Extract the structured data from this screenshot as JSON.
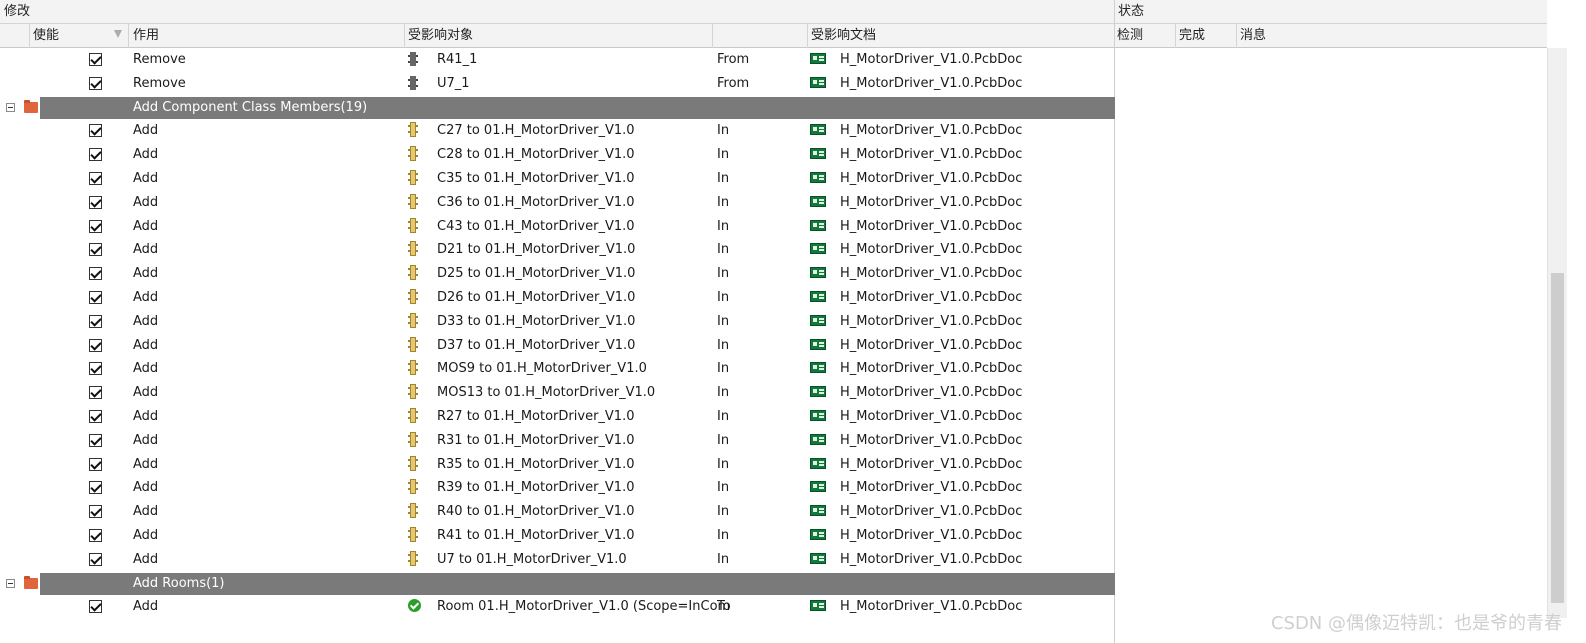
{
  "header": {
    "section_modify": "修改",
    "section_status": "状态",
    "col_enable": "使能",
    "col_action": "作用",
    "col_affected_object": "受影响对象",
    "col_affected_document": "受影响文档",
    "col_check": "检测",
    "col_done": "完成",
    "col_message": "消息"
  },
  "rows": [
    {
      "kind": "item",
      "icon": "chip-icon",
      "action": "Remove",
      "object": "R41_1",
      "dir": "From",
      "doc": "H_MotorDriver_V1.0.PcbDoc"
    },
    {
      "kind": "item",
      "icon": "chip-icon",
      "action": "Remove",
      "object": "U7_1",
      "dir": "From",
      "doc": "H_MotorDriver_V1.0.PcbDoc"
    },
    {
      "kind": "group",
      "label": "Add Component Class Members(19)"
    },
    {
      "kind": "item",
      "icon": "component-icon",
      "action": "Add",
      "object": "C27 to 01.H_MotorDriver_V1.0",
      "dir": "In",
      "doc": "H_MotorDriver_V1.0.PcbDoc"
    },
    {
      "kind": "item",
      "icon": "component-icon",
      "action": "Add",
      "object": "C28 to 01.H_MotorDriver_V1.0",
      "dir": "In",
      "doc": "H_MotorDriver_V1.0.PcbDoc"
    },
    {
      "kind": "item",
      "icon": "component-icon",
      "action": "Add",
      "object": "C35 to 01.H_MotorDriver_V1.0",
      "dir": "In",
      "doc": "H_MotorDriver_V1.0.PcbDoc"
    },
    {
      "kind": "item",
      "icon": "component-icon",
      "action": "Add",
      "object": "C36 to 01.H_MotorDriver_V1.0",
      "dir": "In",
      "doc": "H_MotorDriver_V1.0.PcbDoc"
    },
    {
      "kind": "item",
      "icon": "component-icon",
      "action": "Add",
      "object": "C43 to 01.H_MotorDriver_V1.0",
      "dir": "In",
      "doc": "H_MotorDriver_V1.0.PcbDoc"
    },
    {
      "kind": "item",
      "icon": "component-icon",
      "action": "Add",
      "object": "D21 to 01.H_MotorDriver_V1.0",
      "dir": "In",
      "doc": "H_MotorDriver_V1.0.PcbDoc"
    },
    {
      "kind": "item",
      "icon": "component-icon",
      "action": "Add",
      "object": "D25 to 01.H_MotorDriver_V1.0",
      "dir": "In",
      "doc": "H_MotorDriver_V1.0.PcbDoc"
    },
    {
      "kind": "item",
      "icon": "component-icon",
      "action": "Add",
      "object": "D26 to 01.H_MotorDriver_V1.0",
      "dir": "In",
      "doc": "H_MotorDriver_V1.0.PcbDoc"
    },
    {
      "kind": "item",
      "icon": "component-icon",
      "action": "Add",
      "object": "D33 to 01.H_MotorDriver_V1.0",
      "dir": "In",
      "doc": "H_MotorDriver_V1.0.PcbDoc"
    },
    {
      "kind": "item",
      "icon": "component-icon",
      "action": "Add",
      "object": "D37 to 01.H_MotorDriver_V1.0",
      "dir": "In",
      "doc": "H_MotorDriver_V1.0.PcbDoc"
    },
    {
      "kind": "item",
      "icon": "component-icon",
      "action": "Add",
      "object": "MOS9 to 01.H_MotorDriver_V1.0",
      "dir": "In",
      "doc": "H_MotorDriver_V1.0.PcbDoc"
    },
    {
      "kind": "item",
      "icon": "component-icon",
      "action": "Add",
      "object": "MOS13 to 01.H_MotorDriver_V1.0",
      "dir": "In",
      "doc": "H_MotorDriver_V1.0.PcbDoc"
    },
    {
      "kind": "item",
      "icon": "component-icon",
      "action": "Add",
      "object": "R27 to 01.H_MotorDriver_V1.0",
      "dir": "In",
      "doc": "H_MotorDriver_V1.0.PcbDoc"
    },
    {
      "kind": "item",
      "icon": "component-icon",
      "action": "Add",
      "object": "R31 to 01.H_MotorDriver_V1.0",
      "dir": "In",
      "doc": "H_MotorDriver_V1.0.PcbDoc"
    },
    {
      "kind": "item",
      "icon": "component-icon",
      "action": "Add",
      "object": "R35 to 01.H_MotorDriver_V1.0",
      "dir": "In",
      "doc": "H_MotorDriver_V1.0.PcbDoc"
    },
    {
      "kind": "item",
      "icon": "component-icon",
      "action": "Add",
      "object": "R39 to 01.H_MotorDriver_V1.0",
      "dir": "In",
      "doc": "H_MotorDriver_V1.0.PcbDoc"
    },
    {
      "kind": "item",
      "icon": "component-icon",
      "action": "Add",
      "object": "R40 to 01.H_MotorDriver_V1.0",
      "dir": "In",
      "doc": "H_MotorDriver_V1.0.PcbDoc"
    },
    {
      "kind": "item",
      "icon": "component-icon",
      "action": "Add",
      "object": "R41 to 01.H_MotorDriver_V1.0",
      "dir": "In",
      "doc": "H_MotorDriver_V1.0.PcbDoc"
    },
    {
      "kind": "item",
      "icon": "component-icon",
      "action": "Add",
      "object": "U7 to 01.H_MotorDriver_V1.0",
      "dir": "In",
      "doc": "H_MotorDriver_V1.0.PcbDoc"
    },
    {
      "kind": "group",
      "label": "Add Rooms(1)"
    },
    {
      "kind": "item",
      "icon": "room-ok-icon",
      "action": "Add",
      "object": "Room 01.H_MotorDriver_V1.0 (Scope=InCom",
      "dir": "To",
      "doc": "H_MotorDriver_V1.0.PcbDoc"
    }
  ],
  "watermark": "CSDN @偶像迈特凯：也是爷的青春",
  "colors": {
    "group_bar": "#7a7a7a",
    "folder": "#e0653a",
    "pcb_icon": "#0f7a3c",
    "component_icon": "#e6c870"
  }
}
